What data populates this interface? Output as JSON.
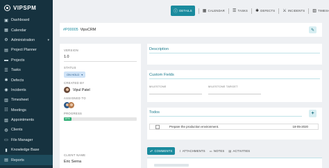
{
  "brand": {
    "name": "VIPSPM"
  },
  "sidebar": {
    "items": [
      {
        "label": "Dashboard",
        "icon": "dashboard-icon",
        "glyph": "▣"
      },
      {
        "label": "Calendar",
        "icon": "calendar-icon",
        "glyph": "▦"
      },
      {
        "label": "Administration",
        "icon": "cog-icon",
        "glyph": "⚙",
        "caret": "▾"
      },
      {
        "label": "Project Planner",
        "icon": "planner-icon",
        "glyph": "▤"
      },
      {
        "label": "Projects",
        "icon": "folder-icon",
        "glyph": "▬"
      },
      {
        "label": "Tasks",
        "icon": "tasks-icon",
        "glyph": "☰"
      },
      {
        "label": "Defects",
        "icon": "bug-icon",
        "glyph": "✱"
      },
      {
        "label": "Incidents",
        "icon": "incident-icon",
        "glyph": "◉"
      },
      {
        "label": "Timesheet",
        "icon": "timesheet-icon",
        "glyph": "▥"
      },
      {
        "label": "Meetings",
        "icon": "meetings-icon",
        "glyph": "☷"
      },
      {
        "label": "Appointments",
        "icon": "appointments-icon",
        "glyph": "▧"
      },
      {
        "label": "Clients",
        "icon": "clients-icon",
        "glyph": "◍"
      },
      {
        "label": "File Manager",
        "icon": "file-icon",
        "glyph": "▭"
      },
      {
        "label": "Knowledge Base",
        "icon": "book-icon",
        "glyph": "▮"
      },
      {
        "label": "Reports",
        "icon": "reports-icon",
        "glyph": "▤"
      }
    ]
  },
  "tabs": [
    {
      "label": "DETAILS",
      "icon": "info-icon",
      "glyph": "ⓘ",
      "active": true
    },
    {
      "label": "CALENDAR",
      "icon": "calendar-icon",
      "glyph": "▦"
    },
    {
      "label": "TASKS",
      "icon": "tasks-icon",
      "glyph": "☰"
    },
    {
      "label": "DEFECTS",
      "icon": "bug-icon",
      "glyph": "✱"
    },
    {
      "label": "INCIDENTS",
      "icon": "incident-icon",
      "glyph": "⚔"
    },
    {
      "label": "TIMESHEET",
      "icon": "timesheet-icon",
      "glyph": "▥"
    }
  ],
  "project": {
    "code": "#P00005",
    "name": "VipsCRM",
    "edit_icon": "edit-icon"
  },
  "details": {
    "version_label": "VERSION",
    "version_value": "1.0",
    "status_label": "STATUS",
    "status_value": "ON HOLD",
    "created_by_label": "CREATED BY",
    "created_by_value": "Vipul Patel",
    "assigned_to_label": "ASSIGNED TO",
    "progress_label": "PROGRESS",
    "progress_value": "10%",
    "progress_fraction": 0.1,
    "client_name_label": "CLIENT NAME",
    "client_name_value": "Eric Serna"
  },
  "description": {
    "title": "Description"
  },
  "custom_fields": {
    "title": "Custom Fields",
    "milestone_label": "MILESTONE",
    "milestone_target_label": "MILESTONE TARGET"
  },
  "todos": {
    "title": "Todos",
    "items": [
      {
        "text": "Prepare the production environment.",
        "date": "18-05-2020"
      }
    ]
  },
  "bottom_tabs": [
    {
      "label": "COMMENTS",
      "icon": "comments-icon",
      "glyph": "☍",
      "active": true
    },
    {
      "label": "ATTACHMENTS",
      "icon": "paperclip-icon",
      "glyph": "⌇"
    },
    {
      "label": "NOTES",
      "icon": "notes-icon",
      "glyph": "▭"
    },
    {
      "label": "ACTIVITIES",
      "icon": "activities-icon",
      "glyph": "▤"
    }
  ],
  "colors": {
    "sidebar": "#16323f",
    "accent": "#1a8b9e",
    "progress": "#2fae74"
  }
}
